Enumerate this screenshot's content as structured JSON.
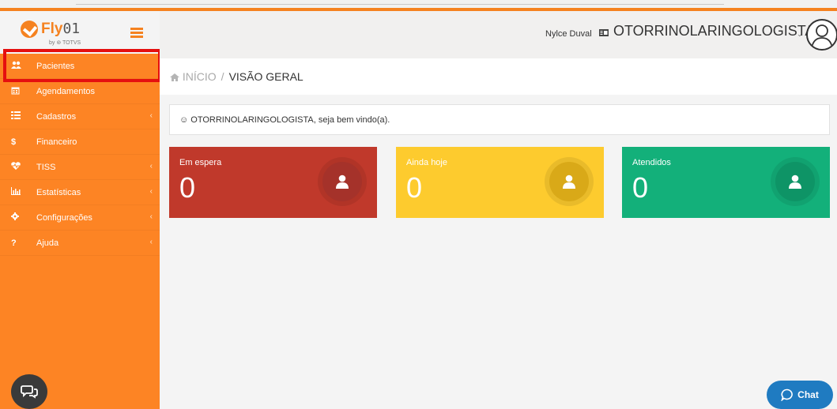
{
  "brand": {
    "name": "Fly",
    "name_digits": "01",
    "sub": "by ⊚ TOTVS"
  },
  "sidebar": {
    "items": [
      {
        "label": "Pacientes",
        "icon": "users-icon",
        "has_submenu": false,
        "active": true
      },
      {
        "label": "Agendamentos",
        "icon": "calendar-icon",
        "has_submenu": false
      },
      {
        "label": "Cadastros",
        "icon": "list-icon",
        "has_submenu": true
      },
      {
        "label": "Financeiro",
        "icon": "dollar-icon",
        "has_submenu": false
      },
      {
        "label": "TISS",
        "icon": "heartbeat-icon",
        "has_submenu": true
      },
      {
        "label": "Estatísticas",
        "icon": "bar-chart-icon",
        "has_submenu": true
      },
      {
        "label": "Configurações",
        "icon": "gear-icon",
        "has_submenu": true
      },
      {
        "label": "Ajuda",
        "icon": "question-icon",
        "has_submenu": true
      }
    ]
  },
  "header": {
    "user_name": "Nylce Duval",
    "role": "OTORRINOLARINGOLOGISTA"
  },
  "breadcrumb": {
    "home": "INÍCIO",
    "separator": "/",
    "current": "VISÃO GERAL"
  },
  "welcome": {
    "text": "☺ OTORRINOLARINGOLOGISTA, seja bem vindo(a)."
  },
  "cards": [
    {
      "label": "Em espera",
      "value": "0",
      "color": "#c0392b",
      "circle": "#a5322a"
    },
    {
      "label": "Ainda hoje",
      "value": "0",
      "color": "#fdcb2e",
      "circle": "#d9a918"
    },
    {
      "label": "Atendidos",
      "value": "0",
      "color": "#13b07a",
      "circle": "#0e9466"
    }
  ],
  "chat": {
    "label": "Chat"
  },
  "colors": {
    "accent": "#f58220",
    "sidebar": "#fd8424",
    "highlight": "#e50f0f",
    "chat": "#1f7bc1"
  }
}
